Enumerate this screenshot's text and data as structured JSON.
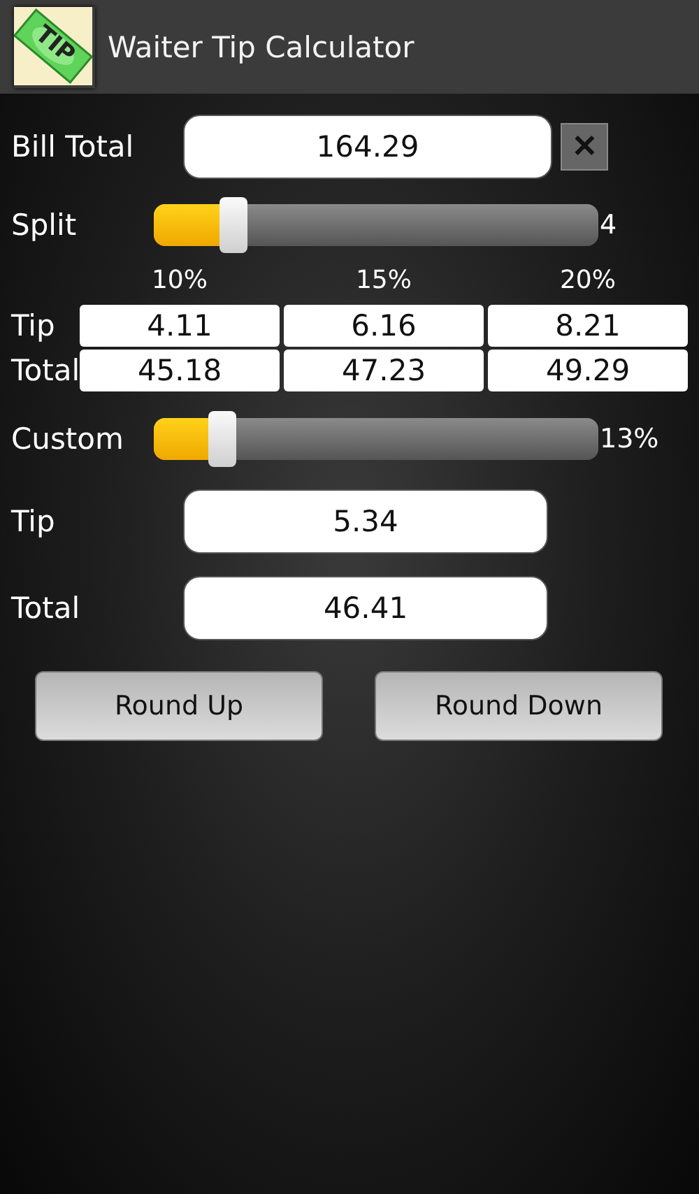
{
  "app_bar": {
    "title": "Waiter Tip Calculator",
    "icon_text": "TIP"
  },
  "bill_total": {
    "label": "Bill Total",
    "value": "164.29",
    "clear_symbol": "✕"
  },
  "split": {
    "label": "Split",
    "level": 0.18,
    "reading": "4"
  },
  "percent_table": {
    "columns": [
      "10%",
      "15%",
      "20%"
    ],
    "rows": [
      {
        "label": "Tip",
        "values": [
          "4.11",
          "6.16",
          "8.21"
        ]
      },
      {
        "label": "Total",
        "values": [
          "45.18",
          "47.23",
          "49.29"
        ]
      }
    ]
  },
  "custom": {
    "label": "Custom",
    "level": 0.155,
    "reading": "13%"
  },
  "results": [
    {
      "label": "Tip",
      "value": "5.34"
    },
    {
      "label": "Total",
      "value": "46.41"
    }
  ],
  "buttons": [
    "Round Up",
    "Round Down"
  ]
}
